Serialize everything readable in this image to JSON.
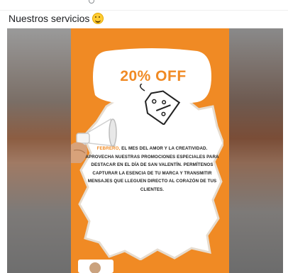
{
  "post": {
    "caption": "Nuestros servicios",
    "emoji": "grinning-face"
  },
  "poster": {
    "offer_text": "20% OFF",
    "message_highlight": "FEBRERO,",
    "message_body": " EL MES DEL AMOR Y LA CREATIVIDAD. APROVECHA NUESTRAS PROMOCIONES ESPECIALES PARA DESTACAR EN EL DÍA DE SAN VALENTÍN. PERMÍTENOS CAPTURAR LA ESENCIA DE TU MARCA Y TRANSMITIR MENSAJES QUE LLEGUEN DIRECTO AL CORAZÓN DE TUS CLIENTES.",
    "accent_color": "#f08a24",
    "icons": [
      "megaphone-icon",
      "price-tag-icon"
    ]
  }
}
